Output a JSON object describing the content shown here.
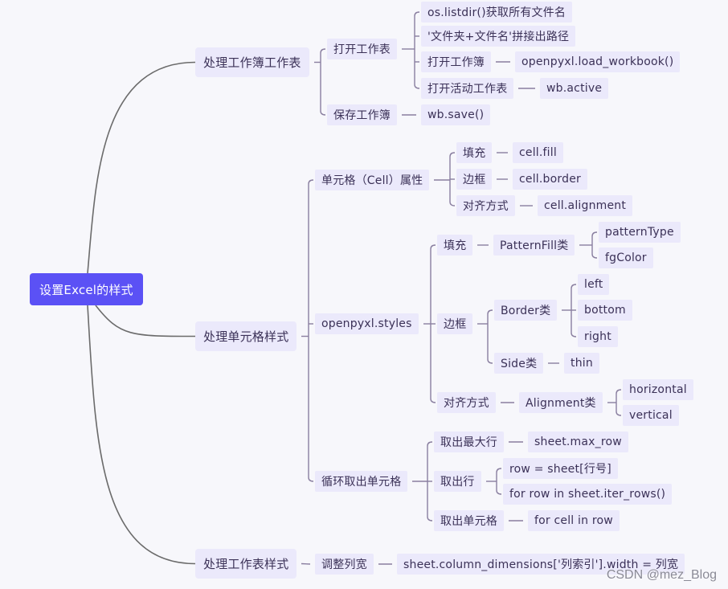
{
  "title": "设置Excel的样式",
  "colors": {
    "root_bg": "#5b51f5",
    "node_bg": "#ebe9fb",
    "text": "#3b3157",
    "line_main": "#6b6b6b",
    "line_branch": "#8a7fa0",
    "background": "#f7f7fb"
  },
  "watermark": "CSDN @mez_Blog",
  "nodes": {
    "root": "设置Excel的样式",
    "wb": "处理工作簿工作表",
    "wb_open": "打开工作表",
    "wb_open_listdir": "os.listdir()获取所有文件名",
    "wb_open_path": "'文件夹+文件名'拼接出路径",
    "wb_open_book": "打开工作簿",
    "wb_open_book_code": "openpyxl.load_workbook()",
    "wb_open_active": "打开活动工作表",
    "wb_open_active_code": "wb.active",
    "wb_save": "保存工作簿",
    "wb_save_code": "wb.save()",
    "cell": "处理单元格样式",
    "cell_attr": "单元格（Cell）属性",
    "cell_attr_fill": "填充",
    "cell_attr_fill_code": "cell.fill",
    "cell_attr_border": "边框",
    "cell_attr_border_code": "cell.border",
    "cell_attr_align": "对齐方式",
    "cell_attr_align_code": "cell.alignment",
    "styles": "openpyxl.styles",
    "styles_fill": "填充",
    "styles_fill_cls": "PatternFill类",
    "styles_fill_pt": "patternType",
    "styles_fill_fg": "fgColor",
    "styles_border": "边框",
    "styles_border_cls": "Border类",
    "styles_border_left": "left",
    "styles_border_bottom": "bottom",
    "styles_border_right": "right",
    "styles_side_cls": "Side类",
    "styles_side_thin": "thin",
    "styles_align": "对齐方式",
    "styles_align_cls": "Alignment类",
    "styles_align_h": "horizontal",
    "styles_align_v": "vertical",
    "loop": "循环取出单元格",
    "loop_max": "取出最大行",
    "loop_max_code": "sheet.max_row",
    "loop_row": "取出行",
    "loop_row_idx": "row = sheet[行号]",
    "loop_row_iter": "for row in sheet.iter_rows()",
    "loop_cell": "取出单元格",
    "loop_cell_code": "for cell in row",
    "ws": "处理工作表样式",
    "ws_width": "调整列宽",
    "ws_width_code": "sheet.column_dimensions['列索引'].width = 列宽"
  },
  "edges": [
    [
      "root",
      "wb"
    ],
    [
      "root",
      "cell"
    ],
    [
      "root",
      "ws"
    ],
    [
      "wb",
      "wb_open"
    ],
    [
      "wb",
      "wb_save"
    ],
    [
      "wb_open",
      "wb_open_listdir"
    ],
    [
      "wb_open",
      "wb_open_path"
    ],
    [
      "wb_open",
      "wb_open_book"
    ],
    [
      "wb_open",
      "wb_open_active"
    ],
    [
      "wb_open_book",
      "wb_open_book_code"
    ],
    [
      "wb_open_active",
      "wb_open_active_code"
    ],
    [
      "wb_save",
      "wb_save_code"
    ],
    [
      "cell",
      "cell_attr"
    ],
    [
      "cell",
      "styles"
    ],
    [
      "cell",
      "loop"
    ],
    [
      "cell_attr",
      "cell_attr_fill"
    ],
    [
      "cell_attr",
      "cell_attr_border"
    ],
    [
      "cell_attr",
      "cell_attr_align"
    ],
    [
      "cell_attr_fill",
      "cell_attr_fill_code"
    ],
    [
      "cell_attr_border",
      "cell_attr_border_code"
    ],
    [
      "cell_attr_align",
      "cell_attr_align_code"
    ],
    [
      "styles",
      "styles_fill"
    ],
    [
      "styles",
      "styles_border"
    ],
    [
      "styles",
      "styles_align"
    ],
    [
      "styles_fill",
      "styles_fill_cls"
    ],
    [
      "styles_fill_cls",
      "styles_fill_pt"
    ],
    [
      "styles_fill_cls",
      "styles_fill_fg"
    ],
    [
      "styles_border",
      "styles_border_cls"
    ],
    [
      "styles_border",
      "styles_side_cls"
    ],
    [
      "styles_border_cls",
      "styles_border_left"
    ],
    [
      "styles_border_cls",
      "styles_border_bottom"
    ],
    [
      "styles_border_cls",
      "styles_border_right"
    ],
    [
      "styles_side_cls",
      "styles_side_thin"
    ],
    [
      "styles_align",
      "styles_align_cls"
    ],
    [
      "styles_align_cls",
      "styles_align_h"
    ],
    [
      "styles_align_cls",
      "styles_align_v"
    ],
    [
      "loop",
      "loop_max"
    ],
    [
      "loop",
      "loop_row"
    ],
    [
      "loop",
      "loop_cell"
    ],
    [
      "loop_max",
      "loop_max_code"
    ],
    [
      "loop_row",
      "loop_row_idx"
    ],
    [
      "loop_row",
      "loop_row_iter"
    ],
    [
      "loop_cell",
      "loop_cell_code"
    ],
    [
      "ws",
      "ws_width"
    ],
    [
      "ws_width",
      "ws_width_code"
    ]
  ]
}
